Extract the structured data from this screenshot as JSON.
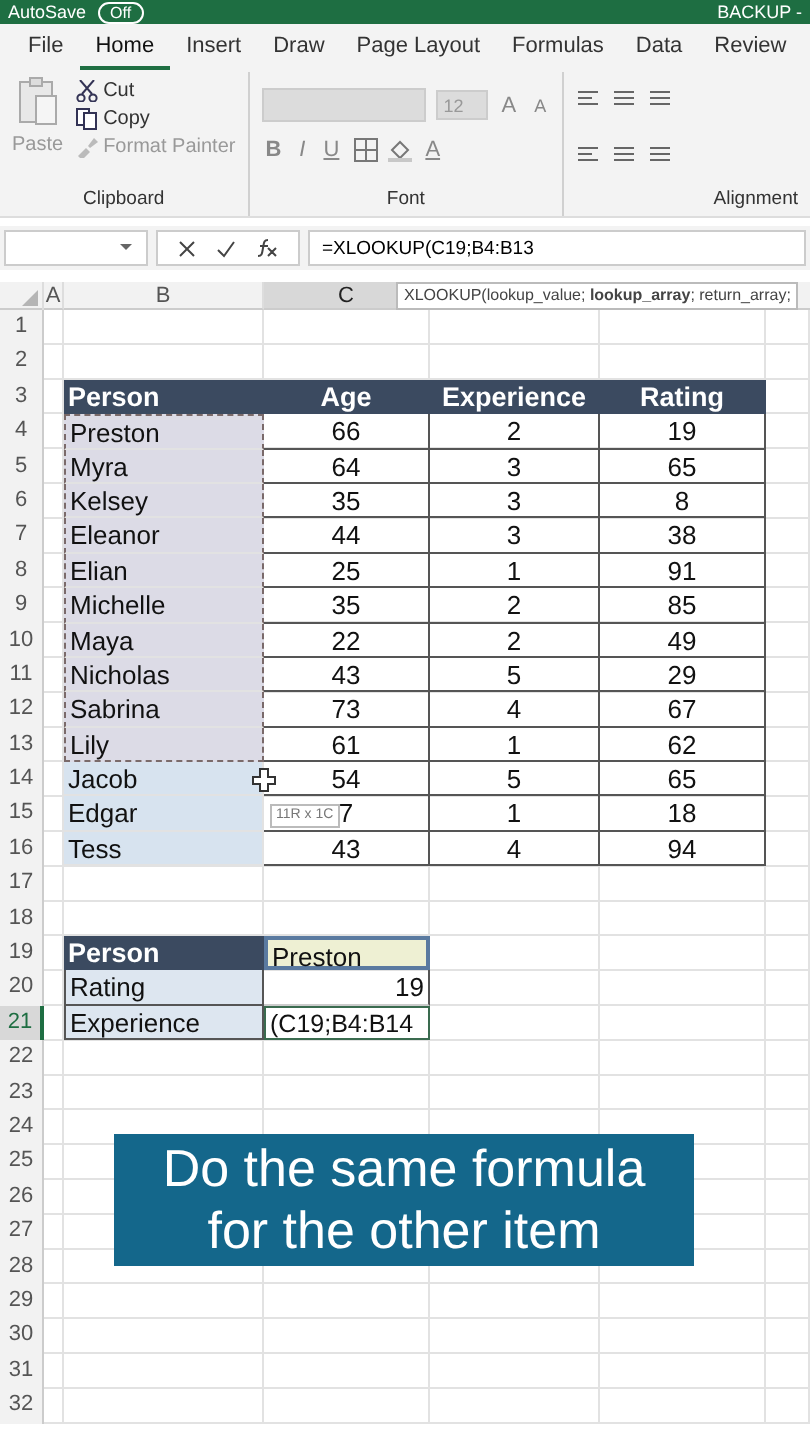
{
  "title_bar": {
    "autosave_label": "AutoSave",
    "autosave": {
      "label": "Off",
      "on": false
    },
    "file_name": "BACKUP -"
  },
  "tabs": [
    {
      "label": "File",
      "selected": false
    },
    {
      "label": "Home",
      "selected": true
    },
    {
      "label": "Insert",
      "selected": false
    },
    {
      "label": "Draw",
      "selected": false
    },
    {
      "label": "Page Layout",
      "selected": false
    },
    {
      "label": "Formulas",
      "selected": false
    },
    {
      "label": "Data",
      "selected": false
    },
    {
      "label": "Review",
      "selected": false
    }
  ],
  "ribbon": {
    "clipboard": {
      "paste": "Paste",
      "cut": "Cut",
      "copy": "Copy",
      "format_painter": "Format Painter",
      "label": "Clipboard"
    },
    "font": {
      "size": "12",
      "grow": "A",
      "shrink": "A",
      "bold": "B",
      "italic": "I",
      "underline": "U",
      "text_tint": "A",
      "label": "Font"
    },
    "alignment": {
      "label": "Alignment"
    }
  },
  "formula_bar": {
    "formula": "=XLOOKUP(C19;B4:B13",
    "tooltip": "XLOOKUP(lookup_value; **lookup_array**; return_array;"
  },
  "columns": [
    {
      "label": "A",
      "selected": false
    },
    {
      "label": "B",
      "selected": false
    },
    {
      "label": "C",
      "selected": true
    }
  ],
  "rows": [
    {
      "number": "1",
      "selected": false,
      "kind": "empty"
    },
    {
      "number": "2",
      "selected": false,
      "kind": "empty"
    },
    {
      "number": "3",
      "selected": false,
      "kind": "header",
      "b": "Person",
      "c": "Age",
      "d": "Experience",
      "e": "Rating"
    },
    {
      "number": "4",
      "selected": false,
      "kind": "data",
      "marked": true,
      "b": "Preston",
      "c": "66",
      "d": "2",
      "e": "19"
    },
    {
      "number": "5",
      "selected": false,
      "kind": "data",
      "marked": true,
      "b": "Myra",
      "c": "64",
      "d": "3",
      "e": "65"
    },
    {
      "number": "6",
      "selected": false,
      "kind": "data",
      "marked": true,
      "b": "Kelsey",
      "c": "35",
      "d": "3",
      "e": "8"
    },
    {
      "number": "7",
      "selected": false,
      "kind": "data",
      "marked": true,
      "b": "Eleanor",
      "c": "44",
      "d": "3",
      "e": "38"
    },
    {
      "number": "8",
      "selected": false,
      "kind": "data",
      "marked": true,
      "b": "Elian",
      "c": "25",
      "d": "1",
      "e": "91"
    },
    {
      "number": "9",
      "selected": false,
      "kind": "data",
      "marked": true,
      "b": "Michelle",
      "c": "35",
      "d": "2",
      "e": "85"
    },
    {
      "number": "10",
      "selected": false,
      "kind": "data",
      "marked": true,
      "b": "Maya",
      "c": "22",
      "d": "2",
      "e": "49"
    },
    {
      "number": "11",
      "selected": false,
      "kind": "data",
      "marked": true,
      "b": "Nicholas",
      "c": "43",
      "d": "5",
      "e": "29"
    },
    {
      "number": "12",
      "selected": false,
      "kind": "data",
      "marked": true,
      "b": "Sabrina",
      "c": "73",
      "d": "4",
      "e": "67"
    },
    {
      "number": "13",
      "selected": false,
      "kind": "data",
      "marked": true,
      "b": "Lily",
      "c": "61",
      "d": "1",
      "e": "62"
    },
    {
      "number": "14",
      "selected": false,
      "kind": "data",
      "marked": false,
      "b": "Jacob",
      "c": "54",
      "d": "5",
      "e": "65"
    },
    {
      "number": "15",
      "selected": false,
      "kind": "data",
      "marked": false,
      "b": "Edgar",
      "c": "7",
      "d": "1",
      "e": "18",
      "tip": "11R x 1C"
    },
    {
      "number": "16",
      "selected": false,
      "kind": "data",
      "marked": false,
      "b": "Tess",
      "c": "43",
      "d": "4",
      "e": "94"
    },
    {
      "number": "17",
      "selected": false,
      "kind": "empty"
    },
    {
      "number": "18",
      "selected": false,
      "kind": "empty"
    },
    {
      "number": "19",
      "selected": false,
      "kind": "lookup_head",
      "b": "Person",
      "c": "Preston"
    },
    {
      "number": "20",
      "selected": false,
      "kind": "lookup_num",
      "b": "Rating",
      "c": "19"
    },
    {
      "number": "21",
      "selected": true,
      "kind": "lookup_edit",
      "b": "Experience",
      "c": "(C19;B4:B14"
    },
    {
      "number": "22",
      "selected": false,
      "kind": "empty"
    },
    {
      "number": "23",
      "selected": false,
      "kind": "empty"
    },
    {
      "number": "24",
      "selected": false,
      "kind": "empty"
    },
    {
      "number": "25",
      "selected": false,
      "kind": "empty"
    },
    {
      "number": "26",
      "selected": false,
      "kind": "empty"
    },
    {
      "number": "27",
      "selected": false,
      "kind": "empty"
    },
    {
      "number": "28",
      "selected": false,
      "kind": "empty"
    },
    {
      "number": "29",
      "selected": false,
      "kind": "empty"
    },
    {
      "number": "30",
      "selected": false,
      "kind": "empty"
    },
    {
      "number": "31",
      "selected": false,
      "kind": "empty"
    },
    {
      "number": "32",
      "selected": false,
      "kind": "empty"
    }
  ],
  "caption": [
    "Do the same formula",
    "for the other item"
  ]
}
